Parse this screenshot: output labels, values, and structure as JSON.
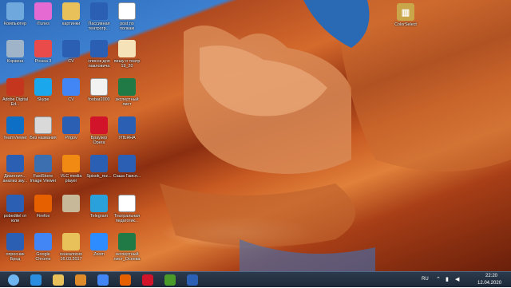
{
  "desktop": {
    "icons": [
      {
        "label": "Компьютер",
        "icon": "computer-icon",
        "color": "#6fa8dc"
      },
      {
        "label": "iTunes",
        "icon": "itunes-icon",
        "color": "#e56ad1"
      },
      {
        "label": "картинки",
        "icon": "folder-icon",
        "color": "#e8c15a"
      },
      {
        "label": "Пассивная театрогр...",
        "icon": "word-doc-icon",
        "color": "#2b5fb3"
      },
      {
        "label": "post по полкам",
        "icon": "document-icon",
        "color": "#ffffff"
      },
      {
        "label": "Корзина",
        "icon": "recycle-bin-icon",
        "color": "#9fb4c8"
      },
      {
        "label": "Picasa 3",
        "icon": "picasa-icon",
        "color": "#e94b4b"
      },
      {
        "label": "CV",
        "icon": "word-doc-icon",
        "color": "#2b5fb3"
      },
      {
        "label": "список для павловича",
        "icon": "word-doc-icon",
        "color": "#2b5fb3"
      },
      {
        "label": "пишу о театр 19_20",
        "icon": "document-icon",
        "color": "#f5e2b8"
      },
      {
        "label": "Adobe Digital Ed...",
        "icon": "adobe-icon",
        "color": "#c5361f"
      },
      {
        "label": "Skype",
        "icon": "skype-icon",
        "color": "#1aa7ec"
      },
      {
        "label": "CV",
        "icon": "chrome-icon",
        "color": "#4285f4"
      },
      {
        "label": "foobar2000",
        "icon": "foobar-icon",
        "color": "#f2f2f2"
      },
      {
        "label": "экспертный лист",
        "icon": "excel-icon",
        "color": "#1f7a45"
      },
      {
        "label": "TeamViewer",
        "icon": "teamviewer-icon",
        "color": "#0e6fc7"
      },
      {
        "label": "Без названия",
        "icon": "image-file-icon",
        "color": "#d9d9d9"
      },
      {
        "label": "Prigov",
        "icon": "word-doc-icon",
        "color": "#2b5fb3"
      },
      {
        "label": "Браузер Opera",
        "icon": "opera-icon",
        "color": "#d1142a"
      },
      {
        "label": "УЛЬЯНА",
        "icon": "word-doc-icon",
        "color": "#2b5fb3"
      },
      {
        "label": "Диагенич... анализ зву...",
        "icon": "word-doc-icon",
        "color": "#2b5fb3"
      },
      {
        "label": "FastStone Image Viewer",
        "icon": "faststone-icon",
        "color": "#3b6fb0"
      },
      {
        "label": "VLC media player",
        "icon": "vlc-icon",
        "color": "#f08a12"
      },
      {
        "label": "Spisok_rez...",
        "icon": "word-doc-icon",
        "color": "#2b5fb3"
      },
      {
        "label": "Саша Гаися...",
        "icon": "word-doc-icon",
        "color": "#2b5fb3"
      },
      {
        "label": "pobeditel от юли",
        "icon": "word-doc-icon",
        "color": "#2b5fb3"
      },
      {
        "label": "Firefox",
        "icon": "firefox-icon",
        "color": "#e66000"
      },
      {
        "label": "",
        "icon": "text-file-icon",
        "color": "#c8b89a"
      },
      {
        "label": "Telegram",
        "icon": "telegram-icon",
        "color": "#2aa1da"
      },
      {
        "label": "Театральная педагогик...",
        "icon": "document-icon",
        "color": "#ffffff"
      },
      {
        "label": "опросник Бред",
        "icon": "word-doc-icon",
        "color": "#2b5fb3"
      },
      {
        "label": "Google Chrome",
        "icon": "chrome-icon",
        "color": "#4285f4"
      },
      {
        "label": "генеалогия 16.03.2017",
        "icon": "folder-icon",
        "color": "#e8c15a"
      },
      {
        "label": "Zoom",
        "icon": "zoom-icon",
        "color": "#2d8cff"
      },
      {
        "label": "экспертный лист_Осеева",
        "icon": "excel-icon",
        "color": "#1f7a45"
      }
    ],
    "right_icon": {
      "label": "ColorSelect",
      "icon": "winrar-archive-icon",
      "color": "#c9a64a"
    }
  },
  "taskbar": {
    "apps": [
      {
        "name": "start-button",
        "icon": "windows-logo-icon",
        "color": "#6fb6f0"
      },
      {
        "name": "ie-taskbar",
        "icon": "internet-explorer-icon",
        "color": "#2a8de0"
      },
      {
        "name": "explorer-taskbar",
        "icon": "folder-icon",
        "color": "#e8c15a"
      },
      {
        "name": "media-taskbar",
        "icon": "media-player-icon",
        "color": "#e08b2a"
      },
      {
        "name": "chrome-taskbar",
        "icon": "chrome-icon",
        "color": "#4285f4"
      },
      {
        "name": "firefox-taskbar",
        "icon": "firefox-icon",
        "color": "#e66000"
      },
      {
        "name": "opera-taskbar",
        "icon": "opera-icon",
        "color": "#d1142a"
      },
      {
        "name": "utorrent-taskbar",
        "icon": "utorrent-icon",
        "color": "#4a9a2a"
      },
      {
        "name": "word-taskbar",
        "icon": "word-icon",
        "color": "#2b5fb3"
      }
    ],
    "language": "RU",
    "time": "22:20",
    "date": "12.04.2020"
  }
}
